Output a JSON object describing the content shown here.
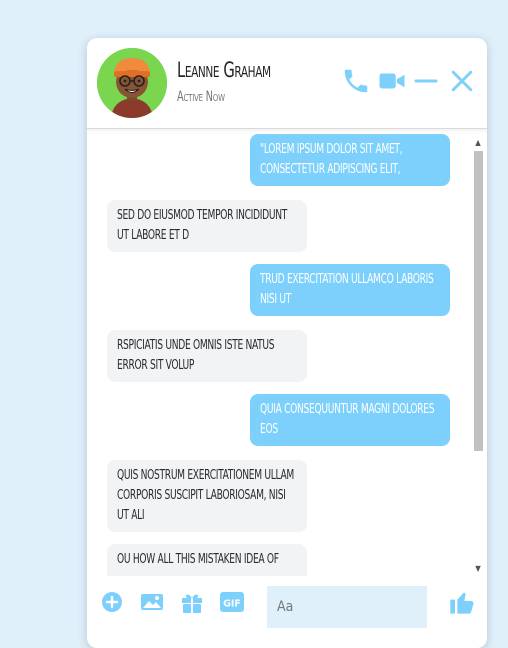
{
  "contact": {
    "name": "Leanne Graham",
    "status": "Active Now"
  },
  "header": {
    "actions": [
      "phone-icon",
      "video-icon",
      "minimize-icon",
      "close-icon"
    ]
  },
  "messages": [
    {
      "direction": "outgoing",
      "text": "\"Lorem ipsum dolor sit amet, consectetur adipiscing elit,"
    },
    {
      "direction": "incoming",
      "text": "sed do eiusmod tempor incididunt ut labore et d"
    },
    {
      "direction": "outgoing",
      "text": "trud exercitation ullamco laboris nisi ut"
    },
    {
      "direction": "incoming",
      "text": "rspiciatis unde omnis iste natus error sit volup"
    },
    {
      "direction": "outgoing",
      "text": "quia consequuntur magni dolores eos"
    },
    {
      "direction": "incoming",
      "text": "quis nostrum exercitationem ullam corporis suscipit laboriosam, nisi ut ali"
    },
    {
      "direction": "incoming",
      "text": "ou how all this mistaken idea of"
    }
  ],
  "footer": {
    "icons": [
      "add-icon",
      "image-icon",
      "gift-icon",
      "gif-icon"
    ],
    "gif_label": "GIF",
    "compose_placeholder": "Aa",
    "like": "thumbs-up-icon"
  },
  "colors": {
    "accent": "#7dd0fb",
    "background": "#dff0fb",
    "incoming_bubble": "#f2f3f5",
    "avatar_bg": "#7bd64f"
  }
}
